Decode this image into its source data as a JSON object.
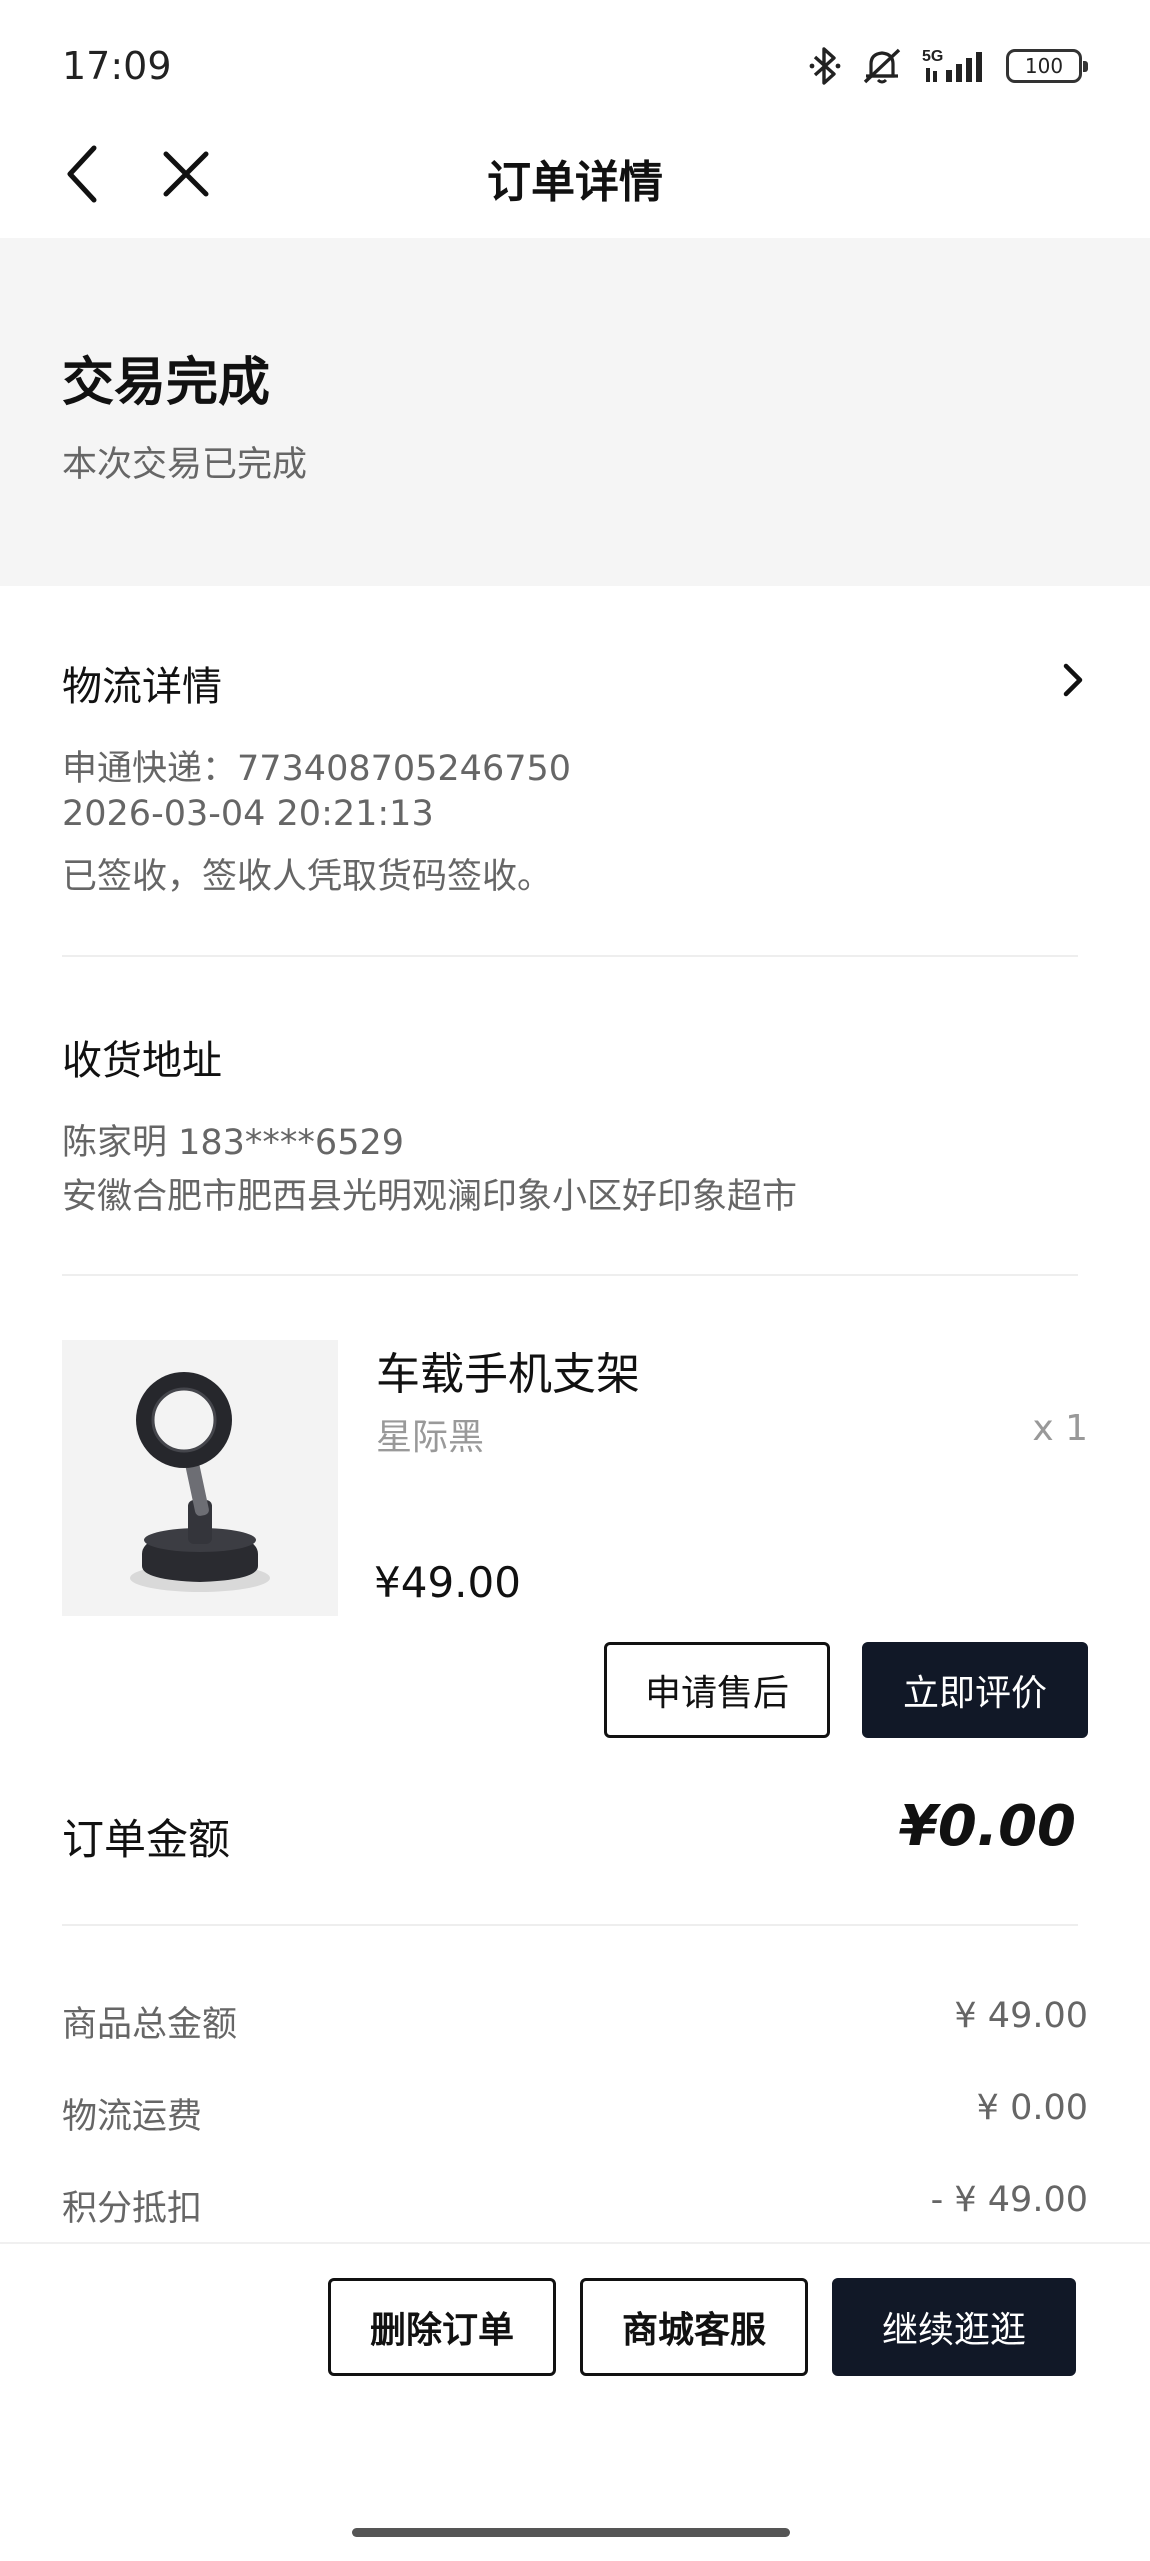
{
  "status_bar": {
    "time": "17:09",
    "network": "5G",
    "battery": "100",
    "icons": [
      "bluetooth-icon",
      "mute-icon",
      "signal-icon",
      "battery-icon"
    ]
  },
  "nav": {
    "title": "订单详情",
    "back_icon": "back-icon",
    "close_icon": "close-icon"
  },
  "order_status": {
    "title": "交易完成",
    "subtitle": "本次交易已完成"
  },
  "logistics": {
    "title": "物流详情",
    "carrier_line": "申通快递：773408705246750",
    "time": "2026-03-04 20:21:13",
    "status": "已签收，签收人凭取货码签收。"
  },
  "address": {
    "title": "收货地址",
    "recipient": "陈家明  183****6529",
    "detail": "安徽合肥市肥西县光明观澜印象小区好印象超市"
  },
  "product": {
    "name": "车载手机支架",
    "spec": "星际黑",
    "qty": "x 1",
    "price": "¥49.00",
    "image_icon": "phone-holder-image",
    "after_sale_label": "申请售后",
    "review_label": "立即评价"
  },
  "order_total": {
    "label": "订单金额",
    "amount": "¥0.00"
  },
  "breakdown": [
    {
      "label": "商品总金额",
      "value": "¥ 49.00"
    },
    {
      "label": "物流运费",
      "value": "¥ 0.00"
    },
    {
      "label": "积分抵扣",
      "value": "- ¥ 49.00"
    }
  ],
  "bottom_actions": {
    "delete_label": "删除订单",
    "service_label": "商城客服",
    "continue_label": "继续逛逛"
  },
  "colors": {
    "dark_button": "#111827",
    "banner_bg": "#f5f5f5",
    "muted_text": "#666666"
  }
}
